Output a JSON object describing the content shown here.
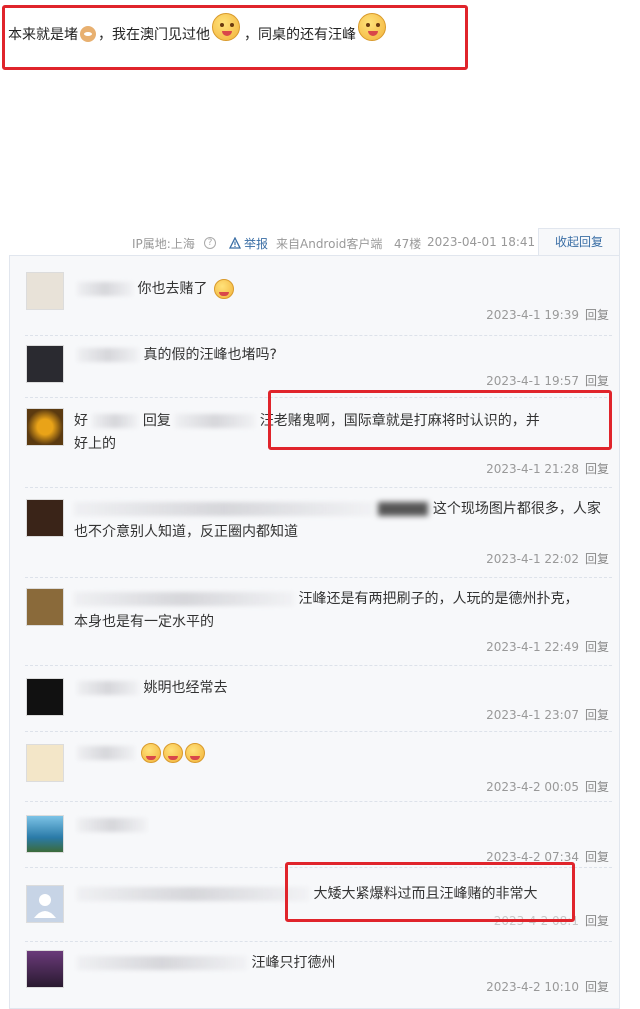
{
  "top_post": {
    "text_1": "本来就是堵",
    "text_2": "，我在澳门见过他",
    "text_3": "，同桌的还有汪峰",
    "emoji_1": "dog-emoji",
    "emoji_2": "tongue-face-emoji",
    "emoji_3": "laugh-face-emoji",
    "highlight_color": "#e0242b"
  },
  "post_meta": {
    "ip": "IP属地:上海",
    "report": "举报",
    "source": "来自Android客户端",
    "floor": "47楼",
    "time": "2023-04-01 18:41",
    "collapse": "收起回复"
  },
  "replies": [
    {
      "text": "你也去赌了",
      "time": "2023-4-1 19:39",
      "reply": "回复"
    },
    {
      "text": "真的假的汪峰也堵吗?",
      "time": "2023-4-1 19:57",
      "reply": "回复"
    },
    {
      "prefix": "好",
      "mid": "回复",
      "text": "汪老赌鬼啊，国际章就是打麻将时认识的，并",
      "line2": "好上的",
      "time": "2023-4-1 21:28",
      "reply": "回复"
    },
    {
      "text": "这个现场图片都很多，人家",
      "line2": "也不介意别人知道，反正圈内都知道",
      "time": "2023-4-1 22:02",
      "reply": "回复"
    },
    {
      "text": "汪峰还是有两把刷子的，人玩的是德州扑克，",
      "line2": "本身也是有一定水平的",
      "time": "2023-4-1 22:49",
      "reply": "回复"
    },
    {
      "text": "姚明也经常去",
      "time": "2023-4-1 23:07",
      "reply": "回复"
    },
    {
      "text": "",
      "time": "2023-4-2 00:05",
      "reply": "回复"
    },
    {
      "text": "",
      "time": "2023-4-2 07:34",
      "reply": "回复"
    },
    {
      "text": "大矮大紧爆料过而且汪峰赌的非常大",
      "time": "2023-4-2 08:1",
      "reply": "回复"
    },
    {
      "text": "汪峰只打德州",
      "time": "2023-4-2 10:10",
      "reply": "回复"
    }
  ]
}
